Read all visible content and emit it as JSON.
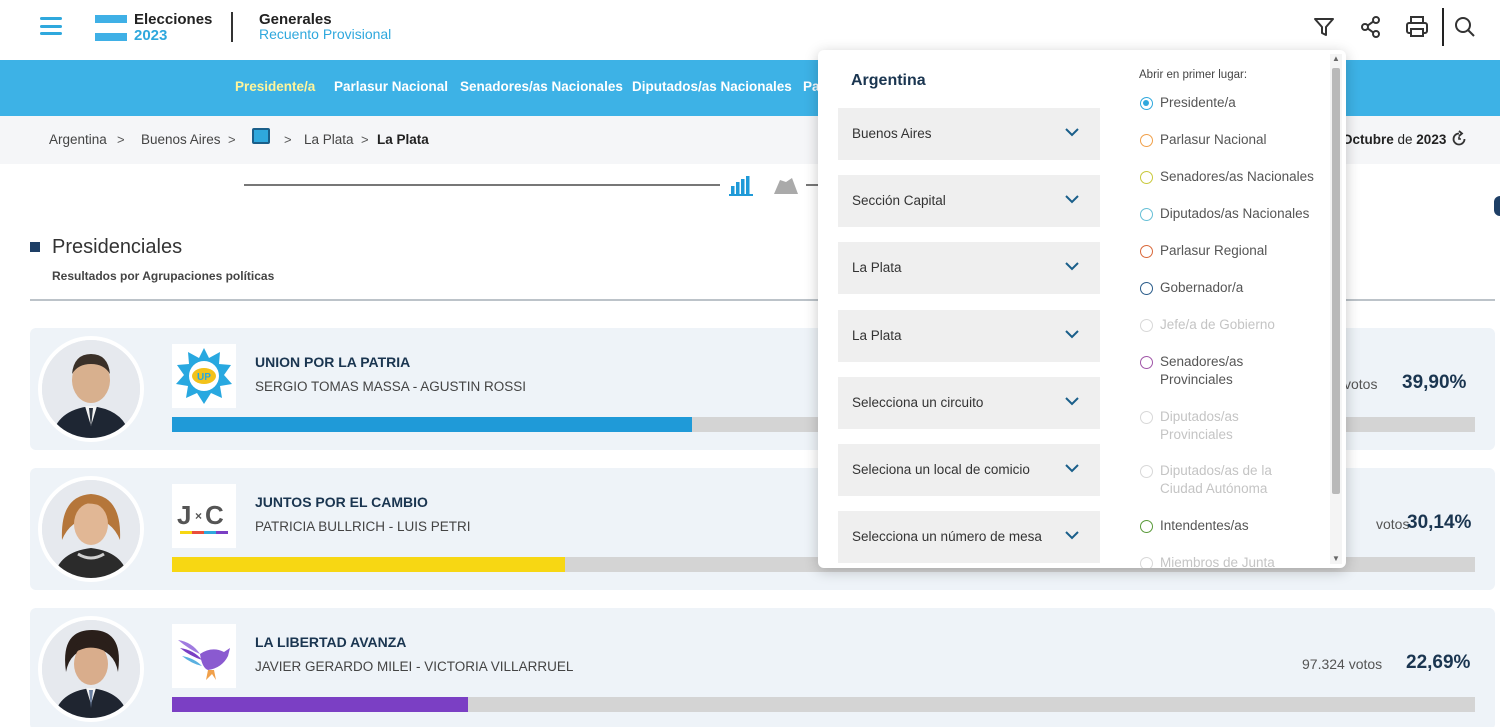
{
  "header": {
    "brand_line1": "Elecciones",
    "brand_line2": "2023",
    "title": "Generales",
    "subtitle": "Recuento Provisional",
    "icons": [
      "filter-icon",
      "share-icon",
      "print-icon",
      "search-icon"
    ]
  },
  "nav": {
    "items": [
      {
        "label": "Presidente/a",
        "active": true
      },
      {
        "label": "Parlasur Nacional",
        "active": false
      },
      {
        "label": "Senadores/as Nacionales",
        "active": false
      },
      {
        "label": "Diputados/as Nacionales",
        "active": false
      },
      {
        "label": "Pa",
        "active": false
      }
    ]
  },
  "breadcrumb": {
    "items": [
      "Argentina",
      "Buenos Aires",
      "La Plata",
      "La Plata"
    ],
    "separator": ">",
    "date_prefix": "Octubre",
    "date_mid": " de ",
    "date_year": "2023"
  },
  "section": {
    "title": "Presidenciales",
    "subtitle": "Resultados por Agrupaciones políticas"
  },
  "candidates": [
    {
      "party": "UNION POR LA PATRIA",
      "names": "SERGIO TOMAS MASSA  -  AGUSTIN ROSSI",
      "votes": "votos",
      "percent": "39,90%",
      "share": 39.9,
      "color": "#1f9ad8",
      "logo": "UP"
    },
    {
      "party": "JUNTOS POR EL CAMBIO",
      "names": "PATRICIA BULLRICH  -  LUIS PETRI",
      "votes": "votos",
      "percent": "30,14%",
      "share": 30.14,
      "color": "#f7d713",
      "logo": "JxC"
    },
    {
      "party": "LA LIBERTAD AVANZA",
      "names": "JAVIER GERARDO MILEI  -  VICTORIA VILLARRUEL",
      "votes": "97.324 votos",
      "percent": "22,69%",
      "share": 22.69,
      "color": "#7b3fc4",
      "logo": "LLA"
    }
  ],
  "panel": {
    "title": "Argentina",
    "selects": [
      "Buenos Aires",
      "Sección Capital",
      "La Plata",
      "La Plata",
      "Selecciona un circuito",
      "Seleciona un local de comicio",
      "Selecciona un número de mesa"
    ],
    "open_first_label": "Abrir en primer lugar:",
    "options": [
      {
        "label": "Presidente/a",
        "checked": true,
        "disabled": false,
        "color": "#2fa8dd"
      },
      {
        "label": "Parlasur Nacional",
        "checked": false,
        "disabled": false,
        "color": "#f0a04a"
      },
      {
        "label": "Senadores/as Nacionales",
        "checked": false,
        "disabled": false,
        "color": "#c9c93c"
      },
      {
        "label": "Diputados/as Nacionales",
        "checked": false,
        "disabled": false,
        "color": "#66bfd6"
      },
      {
        "label": "Parlasur Regional",
        "checked": false,
        "disabled": false,
        "color": "#d9683a"
      },
      {
        "label": "Gobernador/a",
        "checked": false,
        "disabled": false,
        "color": "#2a5c8a"
      },
      {
        "label": "Jefe/a de Gobierno",
        "checked": false,
        "disabled": true,
        "color": "#d8d8d8"
      },
      {
        "label": "Senadores/as\nProvinciales",
        "checked": false,
        "disabled": false,
        "color": "#a056a8"
      },
      {
        "label": "Diputados/as\nProvinciales",
        "checked": false,
        "disabled": true,
        "color": "#d8d8d8"
      },
      {
        "label": "Diputados/as de la\nCiudad Autónoma",
        "checked": false,
        "disabled": true,
        "color": "#d8d8d8"
      },
      {
        "label": "Intendentes/as",
        "checked": false,
        "disabled": false,
        "color": "#5a9a3a"
      },
      {
        "label": "Miembros de Junta",
        "checked": false,
        "disabled": true,
        "color": "#d8d8d8"
      }
    ]
  }
}
